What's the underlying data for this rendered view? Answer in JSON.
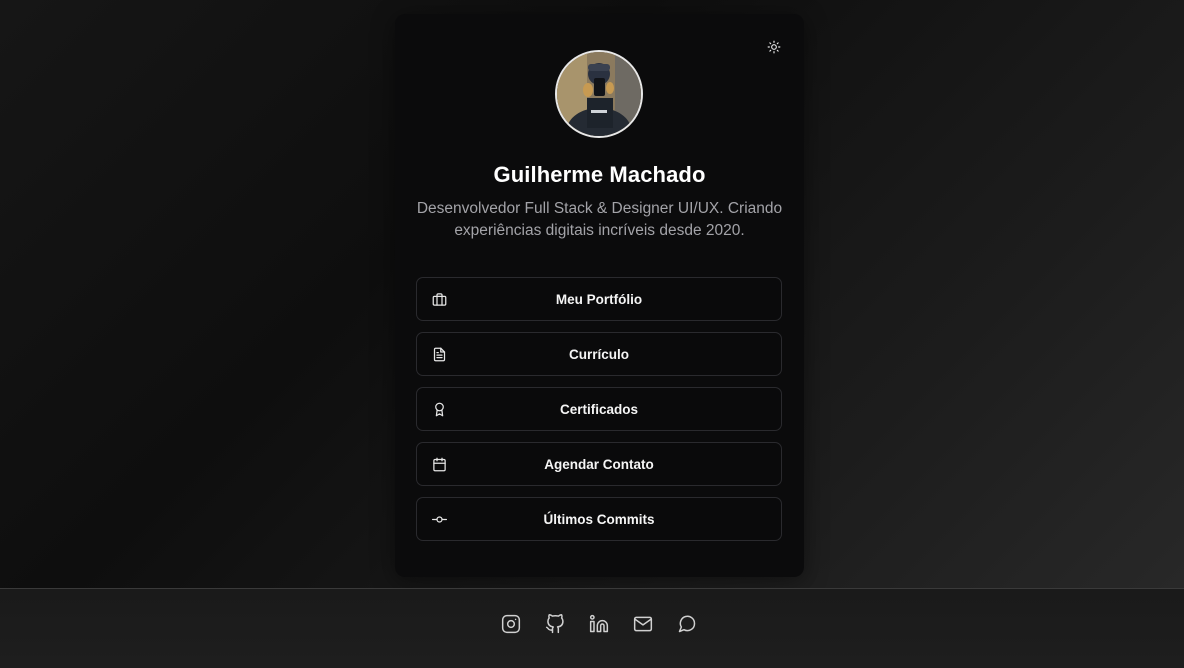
{
  "profile": {
    "name": "Guilherme Machado",
    "bio": "Desenvolvedor Full Stack & Designer UI/UX. Criando experiências digitais incríveis desde 2020."
  },
  "links": [
    {
      "label": "Meu Portfólio",
      "icon": "briefcase-icon"
    },
    {
      "label": "Currículo",
      "icon": "document-icon"
    },
    {
      "label": "Certificados",
      "icon": "award-icon"
    },
    {
      "label": "Agendar Contato",
      "icon": "calendar-icon"
    },
    {
      "label": "Últimos Commits",
      "icon": "git-commit-icon"
    }
  ],
  "socials": [
    {
      "icon": "instagram-icon"
    },
    {
      "icon": "github-icon"
    },
    {
      "icon": "linkedin-icon"
    },
    {
      "icon": "mail-icon"
    },
    {
      "icon": "chat-icon"
    }
  ],
  "theme_toggle": {
    "icon": "sun-icon"
  },
  "colors": {
    "card_background": "#0b0b0c",
    "text_primary": "#ffffff",
    "text_secondary": "#a3a3a8",
    "button_border": "#2a2a2e"
  }
}
